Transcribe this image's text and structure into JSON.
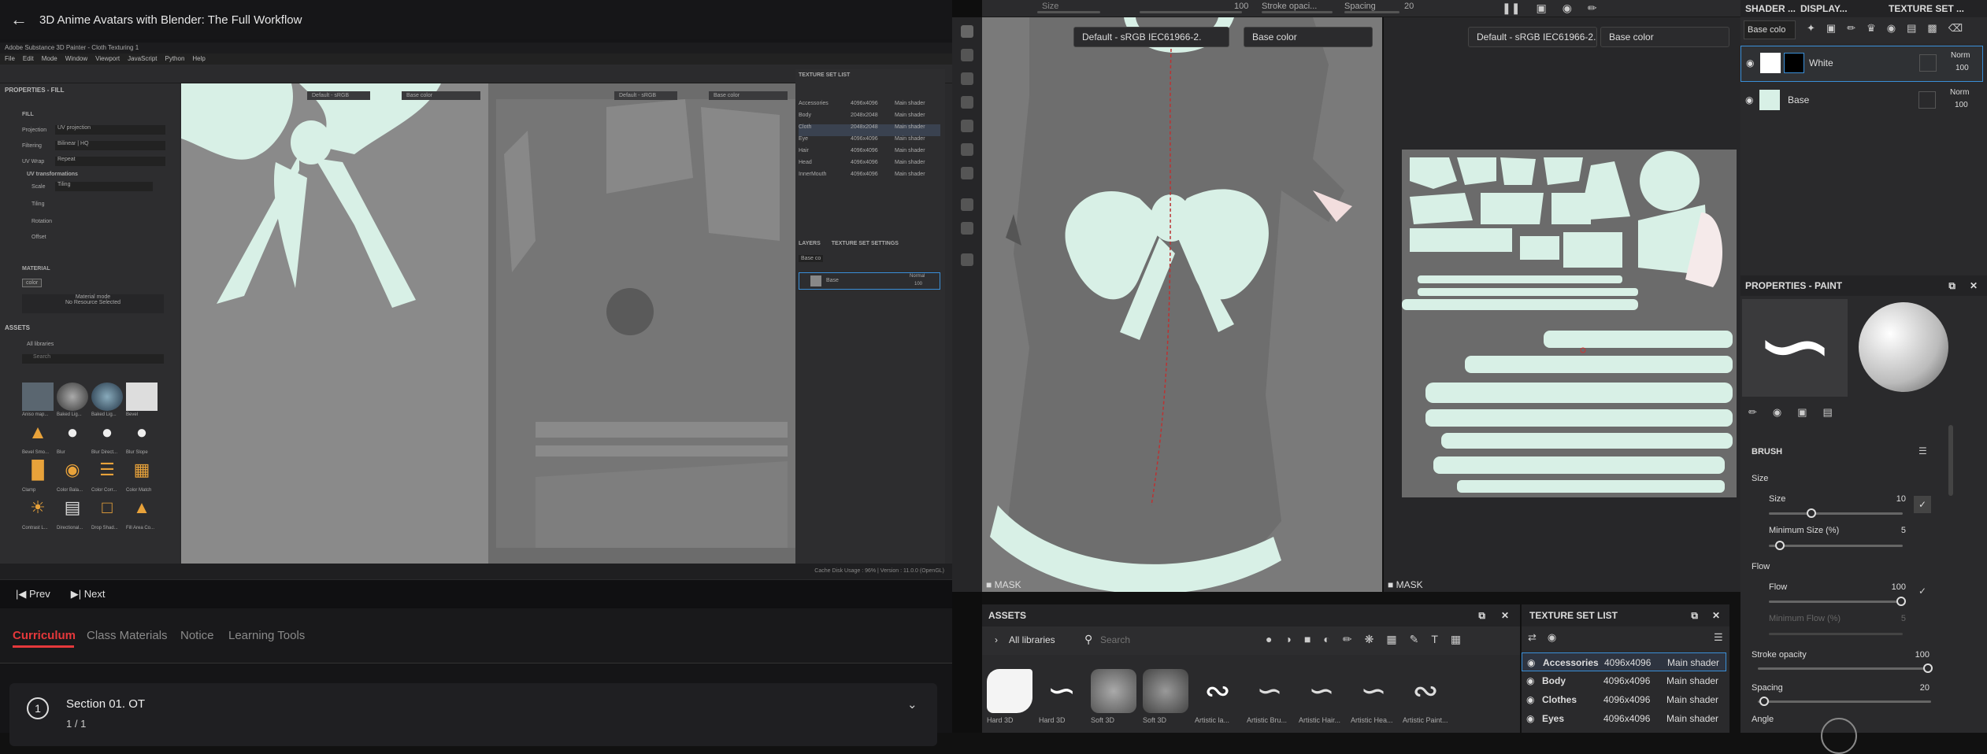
{
  "course": {
    "title": "3D Anime Avatars with Blender: The Full Workflow",
    "back_icon": "arrow-left-icon"
  },
  "video": {
    "window_title": "Adobe Substance 3D Painter - Cloth Texturing 1",
    "menu": [
      "File",
      "Edit",
      "Mode",
      "Window",
      "Viewport",
      "JavaScript",
      "Python",
      "Help"
    ],
    "left_panel_title": "PROPERTIES - FILL",
    "fill_label": "FILL",
    "projection_label": "Projection",
    "projection_value": "UV projection",
    "filtering_label": "Filtering",
    "filtering_value": "Bilinear | HQ",
    "uvwrap_label": "UV Wrap",
    "uvwrap_value": "Repeat",
    "uvtrans_label": "UV transformations",
    "scale_label": "Scale",
    "scale_value": "Tiling",
    "tiling_label": "Tiling",
    "rotation_label": "Rotation",
    "offset_label": "Offset",
    "material_label": "MATERIAL",
    "color_chip": "color",
    "material_mode": "Material mode",
    "no_resource": "No Resource Selected",
    "assets_title": "ASSETS",
    "all_libraries": "All libraries",
    "search_placeholder": "Search",
    "asset_names": [
      "Aniso map...",
      "Baked Lig...",
      "Baked Lig...",
      "Bevel",
      "Bevel Smo...",
      "Blur",
      "Blur Direct...",
      "Blur Slope",
      "Clamp",
      "Color Bala...",
      "Color Corr...",
      "Color Match",
      "Contrast L...",
      "Directional...",
      "Drop Shad...",
      "Fill Area Co..."
    ],
    "viewport1_dropdown": "Default - sRGB",
    "viewport1_channel": "Base color",
    "viewport2_dropdown": "Default - sRGB",
    "viewport2_channel": "Base color",
    "texture_set_title": "TEXTURE SET LIST",
    "texture_sets": [
      {
        "name": "Accessories",
        "res": "4096x4096",
        "shader": "Main shader"
      },
      {
        "name": "Body",
        "res": "2048x2048",
        "shader": "Main shader"
      },
      {
        "name": "Cloth",
        "res": "2048x2048",
        "shader": "Main shader"
      },
      {
        "name": "Eye",
        "res": "4096x4096",
        "shader": "Main shader"
      },
      {
        "name": "Hair",
        "res": "4096x4096",
        "shader": "Main shader"
      },
      {
        "name": "Head",
        "res": "4096x4096",
        "shader": "Main shader"
      },
      {
        "name": "InnerMouth",
        "res": "4096x4096",
        "shader": "Main shader"
      }
    ],
    "layers_tab": "LAYERS",
    "tss_tab": "TEXTURE SET SETTINGS",
    "layer_channel": "Base co",
    "layer_name": "Base",
    "layer_blend": "Normal",
    "layer_opacity": "100",
    "status": "Cache Disk Usage : 96% | Version : 11.0.0 (OpenGL)"
  },
  "nav": {
    "prev": "Prev",
    "next": "Next"
  },
  "tabs": [
    "Curriculum",
    "Class Materials",
    "Notice",
    "Learning Tools"
  ],
  "section": {
    "number": "1",
    "title": "Section 01. OT",
    "progress": "1 / 1"
  },
  "painter": {
    "top_fields": {
      "size_label": "Size",
      "size_val": "10",
      "flow_val": "100",
      "spacing_label": "Spacing",
      "spacing_val": "20",
      "opacity_label": "Stroke opaci..."
    },
    "vp1_colorspace": "Default - sRGB IEC61966-2.",
    "vp1_channel": "Base color",
    "vp2_colorspace": "Default - sRGB IEC61966-2.",
    "vp2_channel": "Base color",
    "mask_label": "MASK",
    "assets_title": "ASSETS",
    "all_libraries": "All libraries",
    "search_placeholder": "Search",
    "brushes": [
      "Hard 3D",
      "Hard 3D",
      "Soft 3D",
      "Soft 3D",
      "Artistic la...",
      "Artistic Bru...",
      "Artistic Hair...",
      "Artistic Hea...",
      "Artistic Paint..."
    ],
    "tsl_title": "TEXTURE SET LIST",
    "texture_sets": [
      {
        "name": "Accessories",
        "res": "4096x4096",
        "shader": "Main shader"
      },
      {
        "name": "Body",
        "res": "4096x4096",
        "shader": "Main shader"
      },
      {
        "name": "Clothes",
        "res": "4096x4096",
        "shader": "Main shader"
      },
      {
        "name": "Eyes",
        "res": "4096x4096",
        "shader": "Main shader"
      }
    ],
    "right_tabs": {
      "shader": "SHADER ...",
      "display": "DISPLAY...",
      "texset": "TEXTURE SET ..."
    },
    "layer_channel": "Base colo",
    "layers": [
      {
        "name": "White",
        "blend": "Norm",
        "opacity": "100"
      },
      {
        "name": "Base",
        "blend": "Norm",
        "opacity": "100"
      }
    ],
    "props_title": "PROPERTIES - PAINT",
    "brush_title": "BRUSH",
    "size_label": "Size",
    "size_sub": "Size",
    "size_value": "10",
    "min_size_label": "Minimum Size (%)",
    "min_size_value": "5",
    "flow_label": "Flow",
    "flow_sub": "Flow",
    "flow_value": "100",
    "min_flow_label": "Minimum Flow (%)",
    "min_flow_value": "5",
    "stroke_opacity_label": "Stroke opacity",
    "stroke_opacity_value": "100",
    "spacing_label": "Spacing",
    "spacing_value": "20",
    "angle_label": "Angle"
  },
  "colors": {
    "accent_red": "#e5383b",
    "selection_blue": "#3a8fd8",
    "mint": "#d8f0e6"
  }
}
